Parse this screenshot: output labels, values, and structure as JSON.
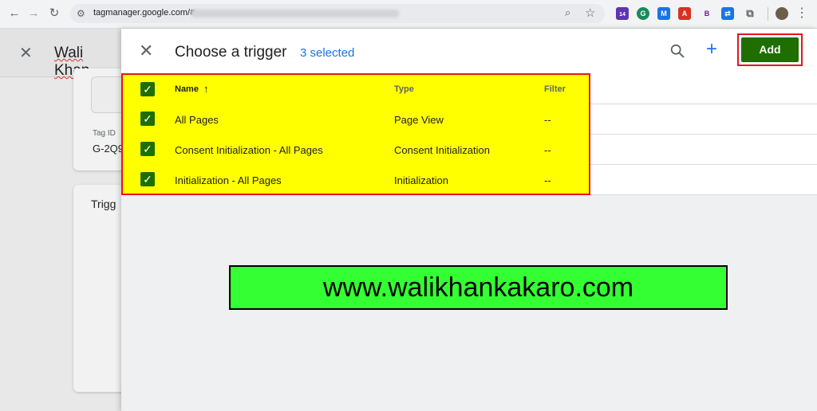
{
  "browser": {
    "url": "tagmanager.google.com/#",
    "extension_badge": "14",
    "accent_colors": {
      "blue": "#1a73e8",
      "add_green": "#1e6e00",
      "highlight_yellow": "#ffff00",
      "highlight_red": "#e8141c",
      "watermark_green": "#33ff33"
    }
  },
  "background_page": {
    "title": "Wali Khan",
    "tag_id_label": "Tag ID",
    "tag_id_value": "G-2Q9",
    "trigger_label": "Trigg"
  },
  "panel": {
    "title": "Choose a trigger",
    "selected_text": "3 selected",
    "add_label": "Add",
    "icons": [
      "close-icon",
      "search-icon",
      "add-icon"
    ]
  },
  "table": {
    "headers": {
      "name": "Name",
      "type": "Type",
      "filter": "Filter",
      "sort_icon": "↑"
    },
    "rows": [
      {
        "name": "All Pages",
        "type": "Page View",
        "filter": "--",
        "checked": true
      },
      {
        "name": "Consent Initialization - All Pages",
        "type": "Consent Initialization",
        "filter": "--",
        "checked": true
      },
      {
        "name": "Initialization - All Pages",
        "type": "Initialization",
        "filter": "--",
        "checked": true
      }
    ]
  },
  "watermark": {
    "text": "www.walikhankakaro.com"
  }
}
